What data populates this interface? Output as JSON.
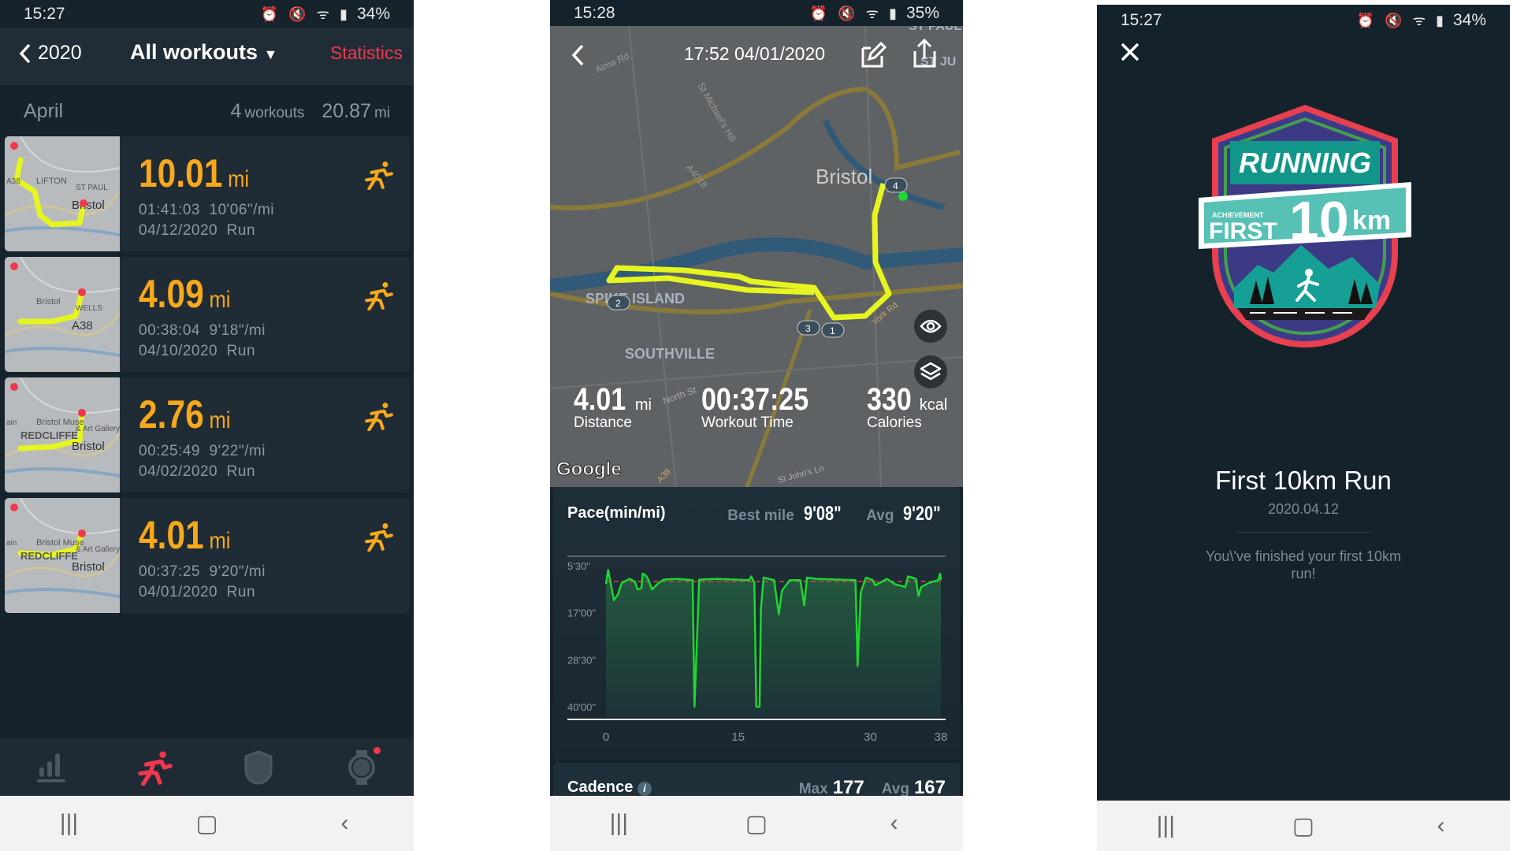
{
  "list_screen": {
    "status": {
      "time": "15:27",
      "battery": "34%"
    },
    "header": {
      "back_label": "2020",
      "title": "All workouts",
      "statistics_label": "Statistics"
    },
    "month": {
      "name": "April",
      "count": "4",
      "count_unit": "workouts",
      "total": "20.87",
      "total_unit": "mi"
    },
    "workouts": [
      {
        "distance": "10.01",
        "unit": "mi",
        "duration": "01:41:03",
        "pace": "10'06\"/mi",
        "date": "04/12/2020",
        "type": "Run",
        "map_labels": [
          "LIFTON",
          "ST PAUL",
          "Bristol",
          "A38"
        ]
      },
      {
        "distance": "4.09",
        "unit": "mi",
        "duration": "00:38:04",
        "pace": "9'18\"/mi",
        "date": "04/10/2020",
        "type": "Run",
        "map_labels": [
          "Bristol",
          "WELLS",
          "A38"
        ]
      },
      {
        "distance": "2.76",
        "unit": "mi",
        "duration": "00:25:49",
        "pace": "9'22\"/mi",
        "date": "04/02/2020",
        "type": "Run",
        "map_labels": [
          "Bristol Muse",
          "& Art Gallery",
          "Bristol",
          "ain",
          "REDCLIFFE"
        ]
      },
      {
        "distance": "4.01",
        "unit": "mi",
        "duration": "00:37:25",
        "pace": "9'20\"/mi",
        "date": "04/01/2020",
        "type": "Run",
        "map_labels": [
          "Bristol Muse",
          "& Art Gallery",
          "Bristol",
          "ain",
          "REDCLIFFE"
        ]
      }
    ],
    "tabs": [
      {
        "icon": "bar-chart-icon",
        "active": false
      },
      {
        "icon": "running-icon",
        "active": true
      },
      {
        "icon": "shield-icon",
        "active": false
      },
      {
        "icon": "watch-icon",
        "active": false,
        "notification": true
      }
    ],
    "colors": {
      "accent": "#f0384d",
      "distance": "#f7a81b",
      "route": "#e6f51f"
    }
  },
  "detail_screen": {
    "status": {
      "time": "15:28",
      "battery": "35%"
    },
    "datetime": "17:52 04/01/2020",
    "map_labels": {
      "alma": "Alma Rd",
      "michael": "St Michael's Hill",
      "a4018": "A4018",
      "bristol": "Bristol",
      "spike": "SPIKE ISLAND",
      "southville": "SOUTHVILLE",
      "york": "York Rd",
      "north": "North St",
      "a38": "A38",
      "stjohn": "St John's Ln",
      "stpaul": "ST PAUL",
      "stju": "ST JU"
    },
    "laps": [
      "1",
      "2",
      "3",
      "4"
    ],
    "google_logo": "Google",
    "stats": {
      "distance": {
        "value": "4.01",
        "unit": "mi",
        "label": "Distance"
      },
      "time": {
        "value": "00:37:25",
        "label": "Workout Time"
      },
      "calories": {
        "value": "330",
        "unit": "kcal",
        "label": "Calories"
      }
    },
    "pace": {
      "title": "Pace(min/mi)",
      "best_label": "Best mile",
      "best_value": "9'08\"",
      "avg_label": "Avg",
      "avg_value": "9'20\""
    },
    "cadence": {
      "title": "Cadence",
      "max_label": "Max",
      "max_value": "177",
      "avg_label": "Avg",
      "avg_value": "167"
    }
  },
  "achievement_screen": {
    "status": {
      "time": "15:27",
      "battery": "34%"
    },
    "badge_text": [
      "RUNNING",
      "ACHIEVEMENT",
      "FIRST",
      "10",
      "km"
    ],
    "title": "First 10km Run",
    "date": "2020.04.12",
    "message": "You\\'ve finished your first 10km run!"
  },
  "chart_data": {
    "type": "area",
    "title": "Pace(min/mi)",
    "x_ticks": [
      "0",
      "15",
      "30",
      "38"
    ],
    "x_tick_values": [
      0,
      15,
      30,
      38
    ],
    "y_ticks": [
      "5'30\"",
      "17'00\"",
      "28'30\"",
      "40'00\""
    ],
    "y_tick_values": [
      5.5,
      17,
      28.5,
      40
    ],
    "ylim": [
      5.5,
      40
    ],
    "y_inverted": true,
    "xlim": [
      0,
      38
    ],
    "avg_line": 9.33,
    "line_color": "#1ed62f",
    "avg_color": "#d9434b",
    "points": [
      [
        0,
        10.0
      ],
      [
        0.24,
        6.5
      ],
      [
        0.89,
        13.9
      ],
      [
        1.34,
        12.6
      ],
      [
        1.79,
        9.7
      ],
      [
        2.68,
        8.7
      ],
      [
        3.28,
        9.4
      ],
      [
        3.58,
        11.3
      ],
      [
        4.02,
        11.0
      ],
      [
        4.17,
        7.4
      ],
      [
        4.47,
        7.8
      ],
      [
        4.77,
        8.7
      ],
      [
        5.22,
        11.3
      ],
      [
        5.96,
        9.7
      ],
      [
        6.56,
        8.9
      ],
      [
        8.05,
        8.7
      ],
      [
        9.83,
        9.0
      ],
      [
        10.04,
        40
      ],
      [
        10.58,
        8.9
      ],
      [
        12.52,
        8.7
      ],
      [
        14.9,
        8.9
      ],
      [
        16.24,
        9.0
      ],
      [
        16.48,
        8.1
      ],
      [
        16.84,
        9.7
      ],
      [
        17.05,
        40
      ],
      [
        17.43,
        40
      ],
      [
        17.58,
        16.1
      ],
      [
        17.88,
        8.4
      ],
      [
        19.07,
        9.0
      ],
      [
        19.61,
        17.4
      ],
      [
        19.97,
        11.6
      ],
      [
        20.86,
        9.0
      ],
      [
        22.05,
        9.0
      ],
      [
        22.5,
        15.2
      ],
      [
        22.8,
        8.4
      ],
      [
        23.84,
        8.7
      ],
      [
        28.31,
        9.0
      ],
      [
        28.55,
        30.0
      ],
      [
        28.91,
        12.0
      ],
      [
        29.5,
        8.4
      ],
      [
        30.25,
        9.0
      ],
      [
        30.55,
        10.3
      ],
      [
        31.89,
        8.7
      ],
      [
        32.78,
        10.0
      ],
      [
        33.97,
        10.7
      ],
      [
        34.27,
        8.1
      ],
      [
        35.16,
        8.7
      ],
      [
        35.46,
        12.9
      ],
      [
        35.76,
        10.7
      ],
      [
        36.65,
        9.7
      ],
      [
        37.7,
        9.0
      ],
      [
        37.9,
        7.4
      ],
      [
        38.0,
        9.0
      ]
    ]
  }
}
